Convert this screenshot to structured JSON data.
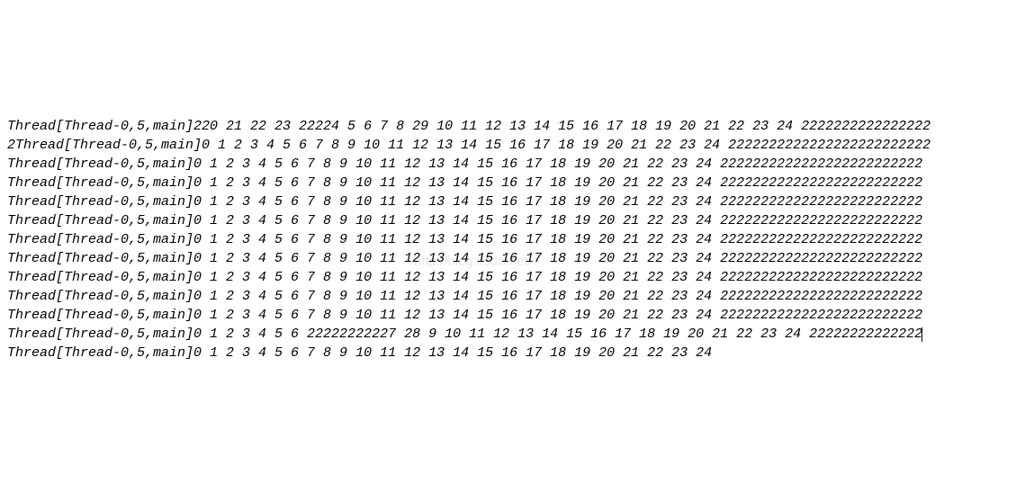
{
  "watermark": "http://blog.csdn.net/",
  "lines": [
    "Thread[Thread-0,5,main]220 21 22 23 22224 5 6 7 8 29 10 11 12 13 14 15 16 17 18 19 20 21 22 23 24 2222222222222222",
    "2Thread[Thread-0,5,main]0 1 2 3 4 5 6 7 8 9 10 11 12 13 14 15 16 17 18 19 20 21 22 23 24 2222222222222222222222222",
    "Thread[Thread-0,5,main]0 1 2 3 4 5 6 7 8 9 10 11 12 13 14 15 16 17 18 19 20 21 22 23 24 2222222222222222222222222",
    "Thread[Thread-0,5,main]0 1 2 3 4 5 6 7 8 9 10 11 12 13 14 15 16 17 18 19 20 21 22 23 24 2222222222222222222222222",
    "Thread[Thread-0,5,main]0 1 2 3 4 5 6 7 8 9 10 11 12 13 14 15 16 17 18 19 20 21 22 23 24 2222222222222222222222222",
    "Thread[Thread-0,5,main]0 1 2 3 4 5 6 7 8 9 10 11 12 13 14 15 16 17 18 19 20 21 22 23 24 2222222222222222222222222",
    "Thread[Thread-0,5,main]0 1 2 3 4 5 6 7 8 9 10 11 12 13 14 15 16 17 18 19 20 21 22 23 24 2222222222222222222222222",
    "Thread[Thread-0,5,main]0 1 2 3 4 5 6 7 8 9 10 11 12 13 14 15 16 17 18 19 20 21 22 23 24 2222222222222222222222222",
    "Thread[Thread-0,5,main]0 1 2 3 4 5 6 7 8 9 10 11 12 13 14 15 16 17 18 19 20 21 22 23 24 2222222222222222222222222",
    "Thread[Thread-0,5,main]0 1 2 3 4 5 6 7 8 9 10 11 12 13 14 15 16 17 18 19 20 21 22 23 24 2222222222222222222222222",
    "Thread[Thread-0,5,main]0 1 2 3 4 5 6 7 8 9 10 11 12 13 14 15 16 17 18 19 20 21 22 23 24 2222222222222222222222222",
    "Thread[Thread-0,5,main]0 1 2 3 4 5 6 22222222227 28 9 10 11 12 13 14 15 16 17 18 19 20 21 22 23 24 22222222222222",
    "Thread[Thread-0,5,main]0 1 2 3 4 5 6 7 8 9 10 11 12 13 14 15 16 17 18 19 20 21 22 23 24"
  ],
  "cursor_after_line_index": 11
}
